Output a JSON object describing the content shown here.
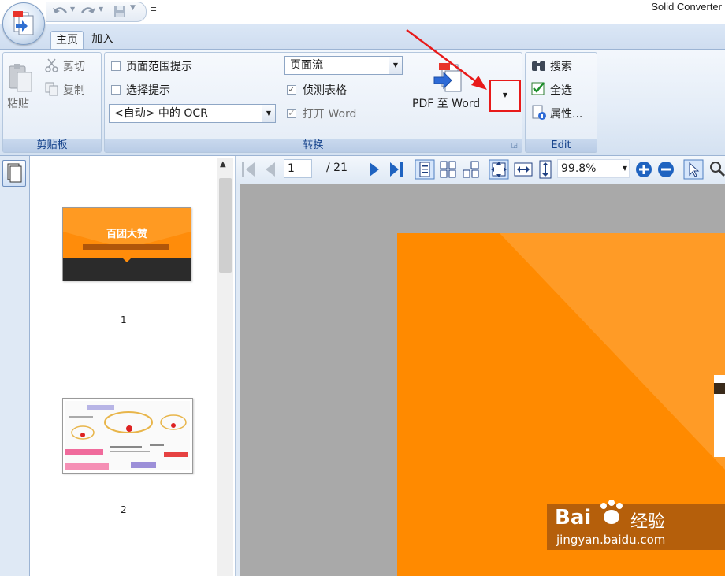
{
  "window": {
    "app_title": "Solid Converter"
  },
  "tabs": [
    {
      "label": "主页",
      "active": true
    },
    {
      "label": "加入",
      "active": false
    }
  ],
  "clipboard": {
    "paste": "粘贴",
    "cut": "剪切",
    "copy": "复制",
    "group_label": "剪贴板"
  },
  "convert": {
    "page_range_hint": {
      "label": "页面范围提示",
      "checked": false
    },
    "selection_hint": {
      "label": "选择提示",
      "checked": false
    },
    "ocr_select": "<自动> 中的 OCR",
    "layout_select": "页面流",
    "detect_tables": {
      "label": "侦测表格",
      "checked": true
    },
    "open_word": {
      "label": "打开 Word",
      "checked": true
    },
    "pdf_to_word": "PDF 至 Word",
    "group_label": "转换"
  },
  "edit": {
    "search": "搜索",
    "select_all": "全选",
    "properties": "属性...",
    "group_label": "Edit"
  },
  "nav": {
    "current_page": "1",
    "total_pages": "/ 21",
    "zoom": "99.8%"
  },
  "thumbnails": [
    {
      "page": "1",
      "title": "百团大赞"
    },
    {
      "page": "2"
    }
  ],
  "watermark": {
    "brand": "Bai",
    "brand_cn": "经验",
    "url": "jingyan.baidu.com"
  },
  "colors": {
    "accent_orange": "#ff8a00",
    "annotation_red": "#e81a1a",
    "ribbon_blue": "#15428b"
  }
}
